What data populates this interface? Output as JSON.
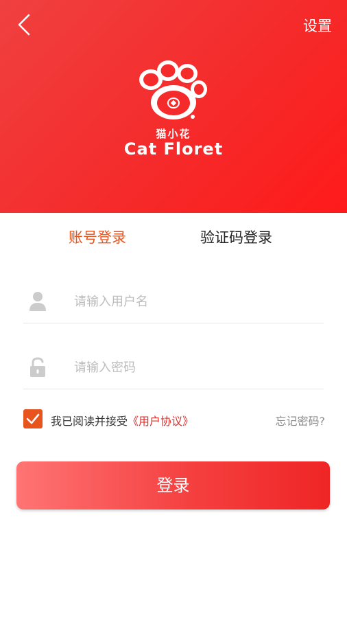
{
  "header": {
    "settings_label": "设置",
    "brand_cn": "猫小花",
    "brand_en": "Cat Floret",
    "accent": "#f52b2b"
  },
  "tabs": [
    {
      "label": "账号登录",
      "active": true
    },
    {
      "label": "验证码登录",
      "active": false
    }
  ],
  "form": {
    "username_placeholder": "请输入用户名",
    "password_placeholder": "请输入密码"
  },
  "agreement": {
    "checked": true,
    "text": "我已阅读并接受",
    "link": "《用户协议》",
    "forgot": "忘记密码?"
  },
  "login_label": "登录",
  "colors": {
    "active_tab": "#e8541e",
    "checkbox": "#e8541e",
    "link": "#e02b2b"
  },
  "icons": [
    "back-arrow-icon",
    "paw-logo-icon",
    "user-icon",
    "lock-icon",
    "checkmark-icon"
  ]
}
